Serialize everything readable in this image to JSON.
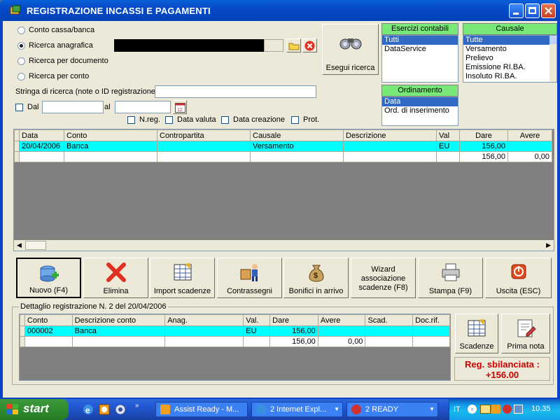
{
  "window": {
    "title": "REGISTRAZIONE INCASSI E PAGAMENTI"
  },
  "search_mode": {
    "options": [
      "Conto cassa/banca",
      "Ricerca anagrafica",
      "Ricerca per documento",
      "Ricerca per conto"
    ],
    "selected": "Ricerca anagrafica"
  },
  "search": {
    "string_label": "Stringa di ricerca (note o ID registrazione)",
    "string_value": "",
    "dal_label": "Dal",
    "al_label": "al",
    "dal_value": "",
    "al_value": "",
    "execute_label": "Esegui ricerca",
    "flags": [
      "N.reg.",
      "Data valuta",
      "Data creazione",
      "Prot."
    ]
  },
  "esercizi": {
    "header": "Esercizi contabili",
    "items": [
      "Tutti",
      "DataService"
    ],
    "selected": "Tutti"
  },
  "ordinamento": {
    "header": "Ordinamento",
    "items": [
      "Data",
      "Ord. di inserimento"
    ],
    "selected": "Data"
  },
  "causale": {
    "header": "Causale",
    "items": [
      "Tutte",
      "Versamento",
      "Prelievo",
      "Emissione RI.BA.",
      "Insoluto RI.BA."
    ],
    "selected": "Tutte"
  },
  "main_grid": {
    "columns": [
      "Data",
      "Conto",
      "Contropartita",
      "Causale",
      "Descrizione",
      "Val",
      "Dare",
      "Avere"
    ],
    "rows": [
      [
        "20/04/2006",
        "Banca",
        "",
        "Versamento",
        "",
        "EU",
        "156,00",
        ""
      ],
      [
        "",
        "",
        "",
        "",
        "",
        "",
        "156,00",
        "0,00"
      ]
    ]
  },
  "toolbar": {
    "nuovo": "Nuovo (F4)",
    "elimina": "Elimina",
    "import": "Import scadenze",
    "contrassegni": "Contrassegni",
    "bonifici": "Bonifici in arrivo",
    "wizard": "Wizard associazione scadenze (F8)",
    "stampa": "Stampa (F9)",
    "uscita": "Uscita (ESC)"
  },
  "detail": {
    "group_label": "Dettaglio registrazione N. 2 del 20/04/2006",
    "columns": [
      "Conto",
      "Descrizione conto",
      "Anag.",
      "Val.",
      "Dare",
      "Avere",
      "Scad.",
      "Doc.rif."
    ],
    "rows": [
      [
        "000002",
        "Banca",
        "",
        "EU",
        "156,00",
        "",
        "",
        ""
      ],
      [
        "",
        "",
        "",
        "",
        "156,00",
        "0,00",
        "",
        ""
      ]
    ],
    "scadenze_label": "Scadenze",
    "prima_nota_label": "Prima nota",
    "status_text": "Reg. sbilanciata : +156.00",
    "status_color": "#cc0000"
  },
  "taskbar": {
    "start_label": "start",
    "tasks": [
      "Assist Ready - M...",
      "2 Internet Expl...",
      "2 READY"
    ],
    "lang": "IT",
    "clock": "10.35"
  }
}
